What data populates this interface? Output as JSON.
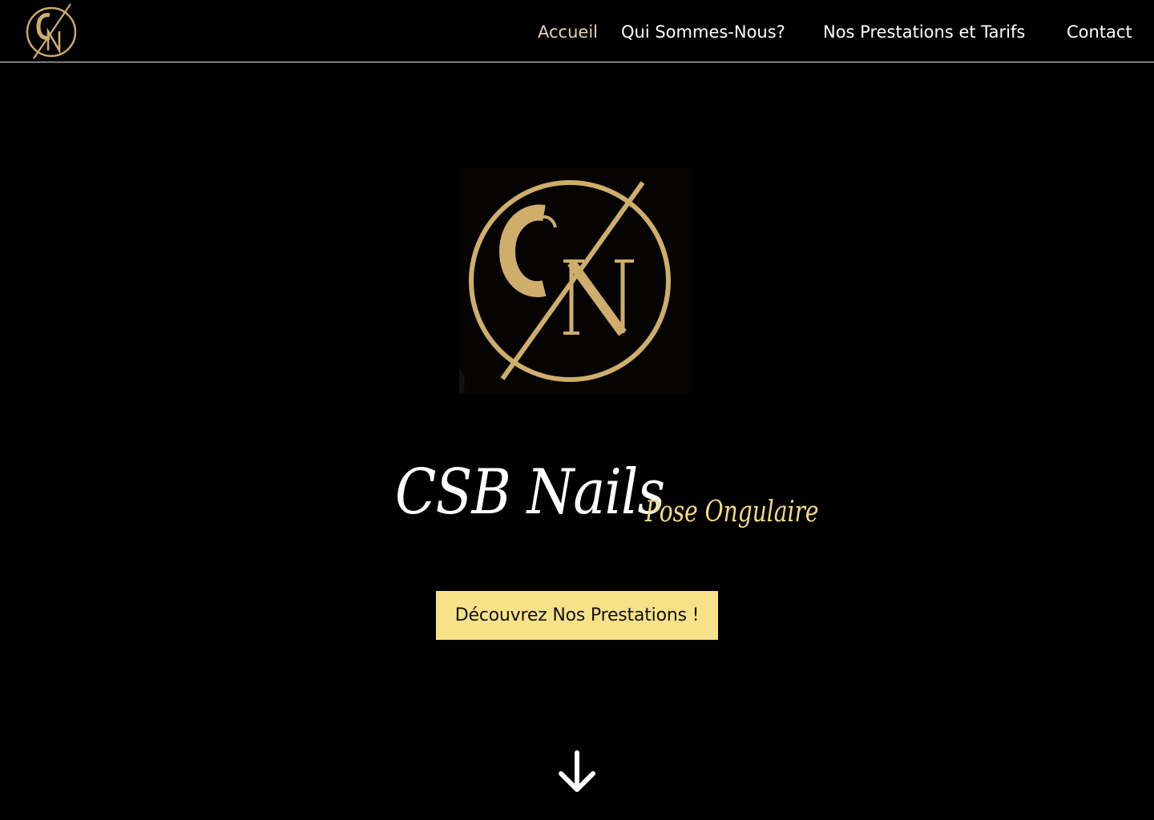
{
  "nav": {
    "logo_letters": "CN",
    "items": [
      {
        "label": "Accueil",
        "active": true
      },
      {
        "label": "Qui Sommes-Nous?",
        "active": false
      },
      {
        "label": "Nos Prestations et Tarifs",
        "active": false
      },
      {
        "label": "Contact",
        "active": false
      }
    ]
  },
  "hero": {
    "logo_letters": "CN",
    "title": "CSB Nails",
    "subtitle": "Pose Ongulaire",
    "cta_label": "Découvrez Nos Prestations !",
    "scroll_icon": "arrow-down-icon"
  },
  "colors": {
    "background": "#000000",
    "gold": "#cfae6b",
    "accent_yellow": "#f7e28a",
    "subtitle_gold": "#f4dc86",
    "nav_text": "#ffffff",
    "nav_active": "#e2d5b0"
  }
}
